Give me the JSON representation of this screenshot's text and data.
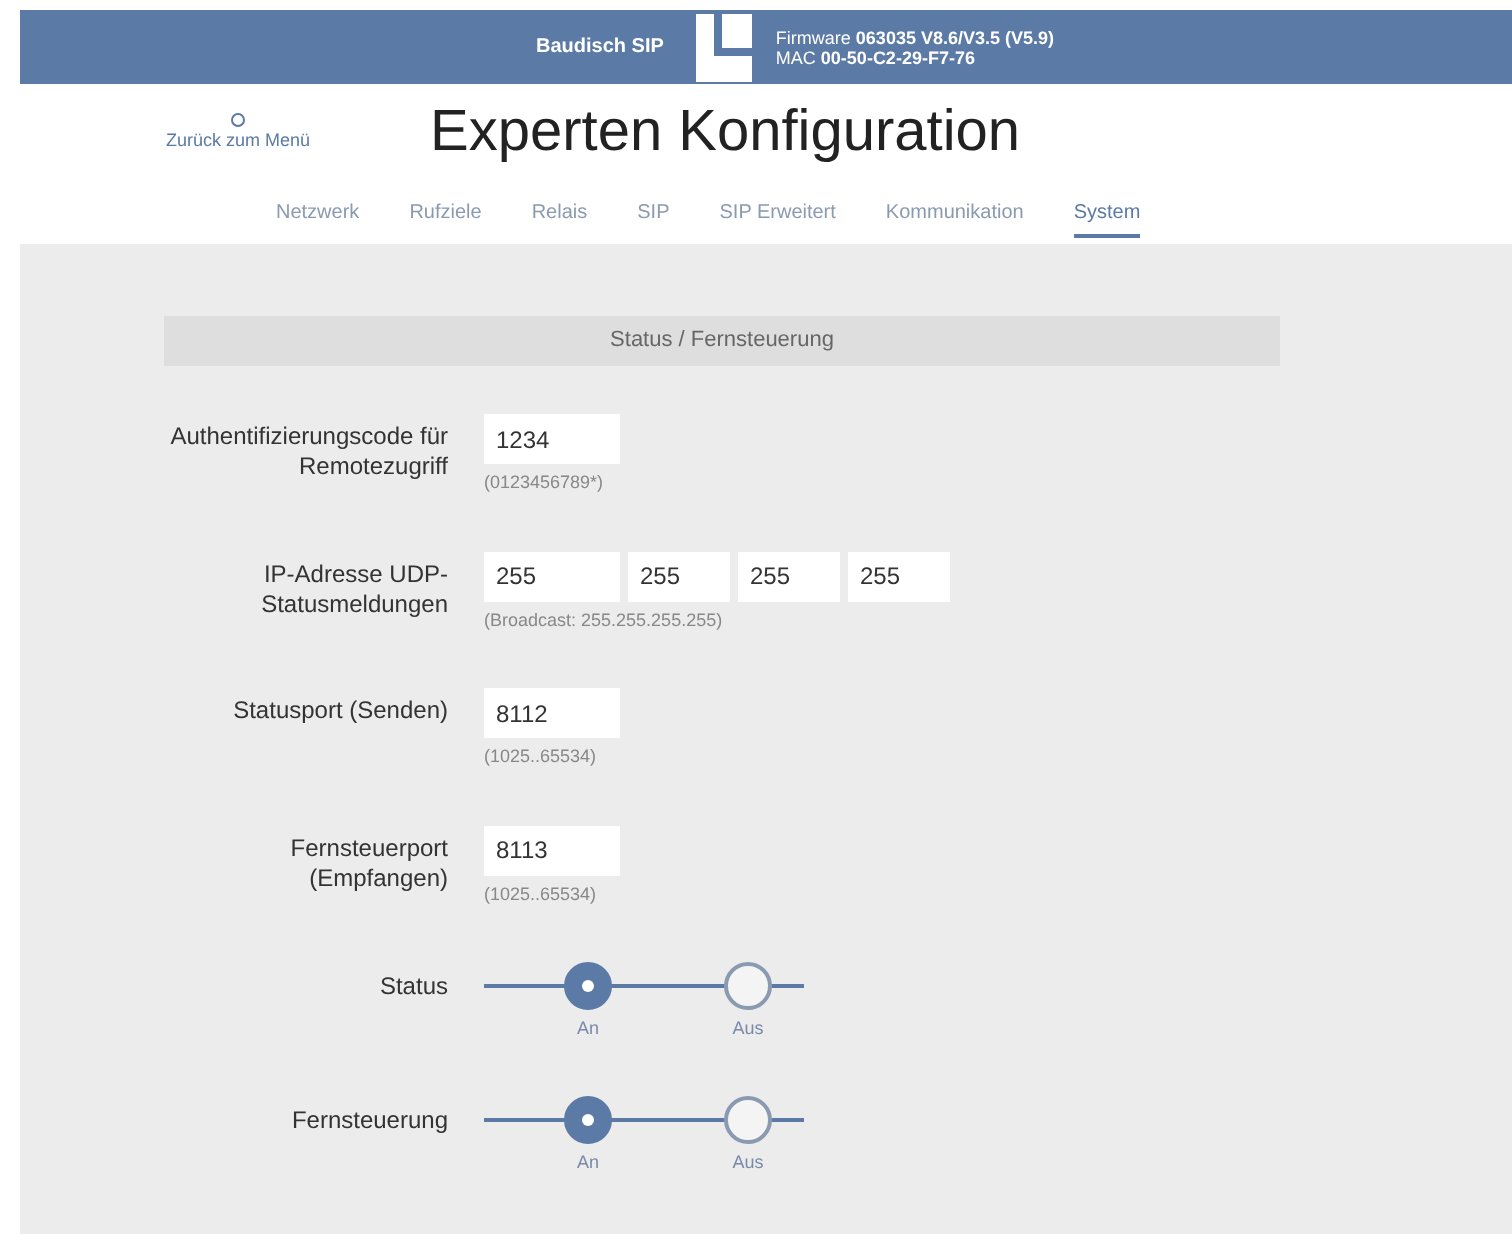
{
  "header": {
    "product": "Baudisch SIP",
    "firmware_label": "Firmware",
    "firmware": "063035 V8.6/V3.5 (V5.9)",
    "mac_label": "MAC",
    "mac": "00-50-C2-29-F7-76"
  },
  "back_link": "Zurück zum Menü",
  "title": "Experten Konfiguration",
  "tabs": [
    {
      "label": "Netzwerk",
      "selected": false
    },
    {
      "label": "Rufziele",
      "selected": false
    },
    {
      "label": "Relais",
      "selected": false
    },
    {
      "label": "SIP",
      "selected": false
    },
    {
      "label": "SIP Erweitert",
      "selected": false
    },
    {
      "label": "Kommunikation",
      "selected": false
    },
    {
      "label": "System",
      "selected": true
    }
  ],
  "section_title": "Status / Fernsteuerung",
  "fields": [
    {
      "kind": "text",
      "label": "Authentifizierungscode für Remotezugriff",
      "values": [
        "1234"
      ],
      "hint": "(0123456789*)"
    },
    {
      "kind": "text",
      "label": "IP-Adresse UDP-Statusmeldungen",
      "values": [
        "255",
        "255",
        "255",
        "255"
      ],
      "hint": "(Broadcast: 255.255.255.255)"
    },
    {
      "kind": "text",
      "label": "Statusport (Senden)",
      "values": [
        "8112"
      ],
      "hint": "(1025..65534)"
    },
    {
      "kind": "text",
      "label": "Fernsteuerport (Empfangen)",
      "values": [
        "8113"
      ],
      "hint": "(1025..65534)"
    },
    {
      "kind": "radio",
      "label": "Status",
      "options": [
        {
          "label": "An",
          "selected": true
        },
        {
          "label": "Aus",
          "selected": false
        }
      ]
    },
    {
      "kind": "radio",
      "label": "Fernsteuerung",
      "options": [
        {
          "label": "An",
          "selected": true
        },
        {
          "label": "Aus",
          "selected": false
        }
      ]
    }
  ]
}
